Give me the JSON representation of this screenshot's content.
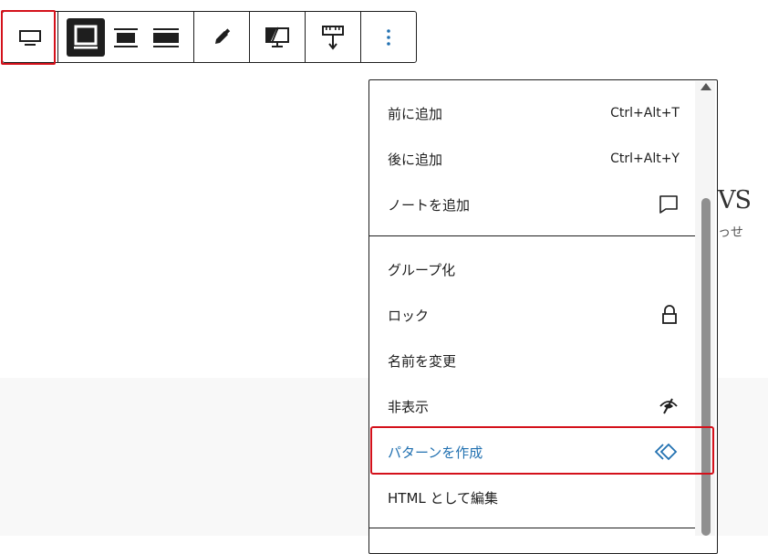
{
  "background": {
    "heading_fragment": "VS",
    "subtext_fragment": "っせ"
  },
  "toolbar": {
    "buttons": [
      {
        "name": "block-type",
        "icon": "block-cover-icon"
      },
      {
        "name": "align-none",
        "icon": "align-none-icon"
      },
      {
        "name": "align-wide",
        "icon": "align-wide-icon"
      },
      {
        "name": "align-full",
        "icon": "align-full-icon"
      },
      {
        "name": "edit",
        "icon": "pencil-icon"
      },
      {
        "name": "toggle-overlay",
        "icon": "overlay-icon"
      },
      {
        "name": "height",
        "icon": "height-icon"
      },
      {
        "name": "options",
        "icon": "more-vertical-icon"
      }
    ],
    "accent_color": "#2271b1"
  },
  "menu": {
    "items": [
      {
        "label": "前に追加",
        "shortcut": "Ctrl+Alt+T"
      },
      {
        "label": "後に追加",
        "shortcut": "Ctrl+Alt+Y"
      },
      {
        "label": "ノートを追加",
        "icon": "comment-icon"
      },
      {
        "label": "グループ化"
      },
      {
        "label": "ロック",
        "icon": "lock-icon"
      },
      {
        "label": "名前を変更"
      },
      {
        "label": "非表示",
        "icon": "hidden-eye-icon"
      },
      {
        "label": "パターンを作成",
        "icon": "pattern-icon",
        "accent": true
      },
      {
        "label": "HTML として編集"
      }
    ]
  },
  "highlight_color": "#d4111b"
}
